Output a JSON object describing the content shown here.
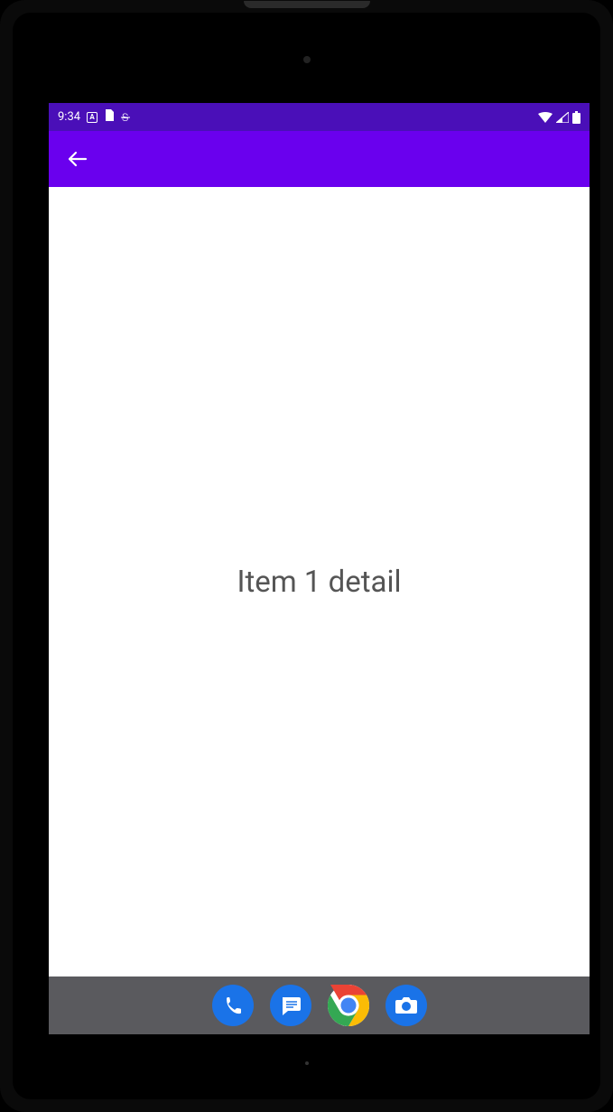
{
  "status_bar": {
    "time": "9:34",
    "icon_a_label": "A",
    "icon_s_label": "S"
  },
  "app_bar": {
    "back_label": "Back"
  },
  "content": {
    "detail_text": "Item 1 detail"
  },
  "nav_bar": {
    "phone_label": "Phone",
    "messages_label": "Messages",
    "chrome_label": "Chrome",
    "camera_label": "Camera"
  },
  "colors": {
    "status_bar": "#4A0FB8",
    "app_bar": "#6A00EE",
    "nav_bar": "#5A5A5E",
    "accent_blue": "#1A73E8"
  }
}
